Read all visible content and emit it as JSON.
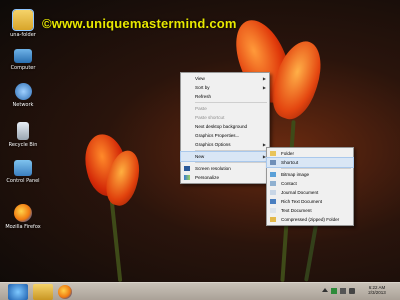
{
  "watermark": "©www.uniquemastermind.com",
  "desktop_icons": [
    {
      "label": "una-folder",
      "icon": "folder-icon"
    },
    {
      "label": "Computer",
      "icon": "computer-icon"
    },
    {
      "label": "Network",
      "icon": "network-icon"
    },
    {
      "label": "Recycle Bin",
      "icon": "recycle-bin-icon"
    },
    {
      "label": "Control Panel",
      "icon": "control-panel-icon"
    },
    {
      "label": "Mozilla Firefox",
      "icon": "firefox-icon"
    }
  ],
  "context_menu": {
    "view": "View",
    "sort_by": "Sort by",
    "refresh": "Refresh",
    "paste": "Paste",
    "paste_shortcut": "Paste shortcut",
    "next_bg": "Next desktop background",
    "graphics_properties": "Graphics Properties...",
    "graphics_options": "Graphics Options",
    "new": "New",
    "screen_resolution": "Screen resolution",
    "personalize": "Personalize"
  },
  "new_submenu": {
    "folder": "Folder",
    "shortcut": "Shortcut",
    "bitmap": "Bitmap image",
    "contact": "Contact",
    "journal": "Journal Document",
    "rtf": "Rich Text Document",
    "text": "Text Document",
    "zip": "Compressed (zipped) Folder"
  },
  "taskbar": {
    "pinned": [
      "internet-explorer-icon",
      "file-explorer-icon",
      "firefox-icon"
    ],
    "time": "6:22 AM",
    "date": "2/3/2013"
  },
  "colors": {
    "watermark": "#e8e800",
    "menu_bg": "#f0f0f0",
    "menu_highlight": "#d9e6f5",
    "taskbar": "#b8afa5"
  }
}
